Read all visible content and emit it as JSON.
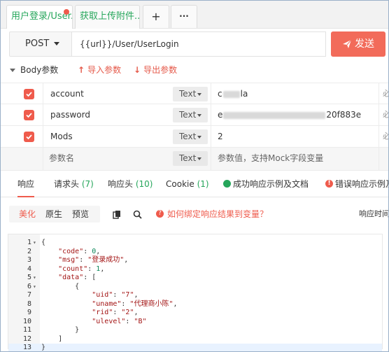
{
  "tabs": [
    {
      "label": "用户登录/User...",
      "active": true,
      "modified": true
    },
    {
      "label": "获取上传附件...",
      "active": false,
      "modified": false
    }
  ],
  "tab_actions": {
    "add": "+",
    "more": "···"
  },
  "request": {
    "method": "POST",
    "url": "{{url}}/User/UserLogin",
    "send_label": "发送"
  },
  "body_section": {
    "title": "Body参数",
    "import_label": "导入参数",
    "export_label": "导出参数"
  },
  "params": [
    {
      "checked": true,
      "name": "account",
      "type": "Text",
      "value_prefix": "c",
      "value_suffix": "la"
    },
    {
      "checked": true,
      "name": "password",
      "type": "Text",
      "value_prefix": "e",
      "value_suffix": "20f883e"
    },
    {
      "checked": true,
      "name": "Mods",
      "type": "Text",
      "value_prefix": "2",
      "value_suffix": ""
    }
  ],
  "param_placeholder": {
    "name": "参数名",
    "type": "Text",
    "value": "参数值，支持Mock字段变量"
  },
  "param_trailing": "必",
  "response_tabs": [
    {
      "label": "响应",
      "count": ""
    },
    {
      "label": "请求头",
      "count": "(7)"
    },
    {
      "label": "响应头",
      "count": "(10)"
    },
    {
      "label": "Cookie",
      "count": "(1)"
    },
    {
      "label": "成功响应示例及文档",
      "count": ""
    },
    {
      "label": "错误响应示例及",
      "count": ""
    }
  ],
  "format_options": [
    "美化",
    "原生",
    "预览"
  ],
  "bind_help": "如何绑定响应结果到变量？",
  "response_time_label": "响应时间",
  "code_lines": [
    "{",
    "    \"code\": 0,",
    "    \"msg\": \"登录成功\",",
    "    \"count\": 1,",
    "    \"data\": [",
    "        {",
    "            \"uid\": \"7\",",
    "            \"uname\": \"代理商小陈\",",
    "            \"rid\": \"2\",",
    "            \"ulevel\": \"B\"",
    "        }",
    "    ]",
    "}"
  ],
  "foldable_lines": [
    1,
    5,
    6
  ],
  "colors": {
    "accent": "#ef5b4c",
    "green": "#26a65b",
    "send": "#f26b5a"
  }
}
